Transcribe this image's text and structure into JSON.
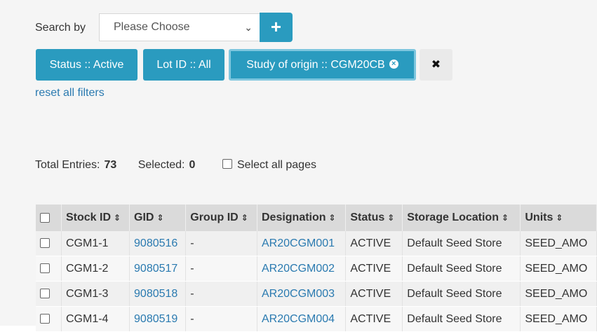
{
  "search": {
    "label": "Search by",
    "placeholder": "Please Choose",
    "add_label": "+"
  },
  "filters": [
    {
      "label": "Status :: Active"
    },
    {
      "label": "Lot ID :: All"
    },
    {
      "label": "Study of origin :: CGM20CB"
    }
  ],
  "clear_filters_label": "✖",
  "reset_link": "reset all filters",
  "summary": {
    "total_label": "Total Entries:",
    "total_value": "73",
    "selected_label": "Selected:",
    "selected_value": "0",
    "select_all_label": "Select all pages"
  },
  "table": {
    "columns": [
      "Stock ID",
      "GID",
      "Group ID",
      "Designation",
      "Status",
      "Storage Location",
      "Units"
    ],
    "sort_icon": "⇕",
    "rows": [
      {
        "stock_id": "CGM1-1",
        "gid": "9080516",
        "group_id": "-",
        "designation": "AR20CGM001",
        "status": "ACTIVE",
        "location": "Default Seed Store",
        "units": "SEED_AMO"
      },
      {
        "stock_id": "CGM1-2",
        "gid": "9080517",
        "group_id": "-",
        "designation": "AR20CGM002",
        "status": "ACTIVE",
        "location": "Default Seed Store",
        "units": "SEED_AMO"
      },
      {
        "stock_id": "CGM1-3",
        "gid": "9080518",
        "group_id": "-",
        "designation": "AR20CGM003",
        "status": "ACTIVE",
        "location": "Default Seed Store",
        "units": "SEED_AMO"
      },
      {
        "stock_id": "CGM1-4",
        "gid": "9080519",
        "group_id": "-",
        "designation": "AR20CGM004",
        "status": "ACTIVE",
        "location": "Default Seed Store",
        "units": "SEED_AMO"
      }
    ]
  }
}
